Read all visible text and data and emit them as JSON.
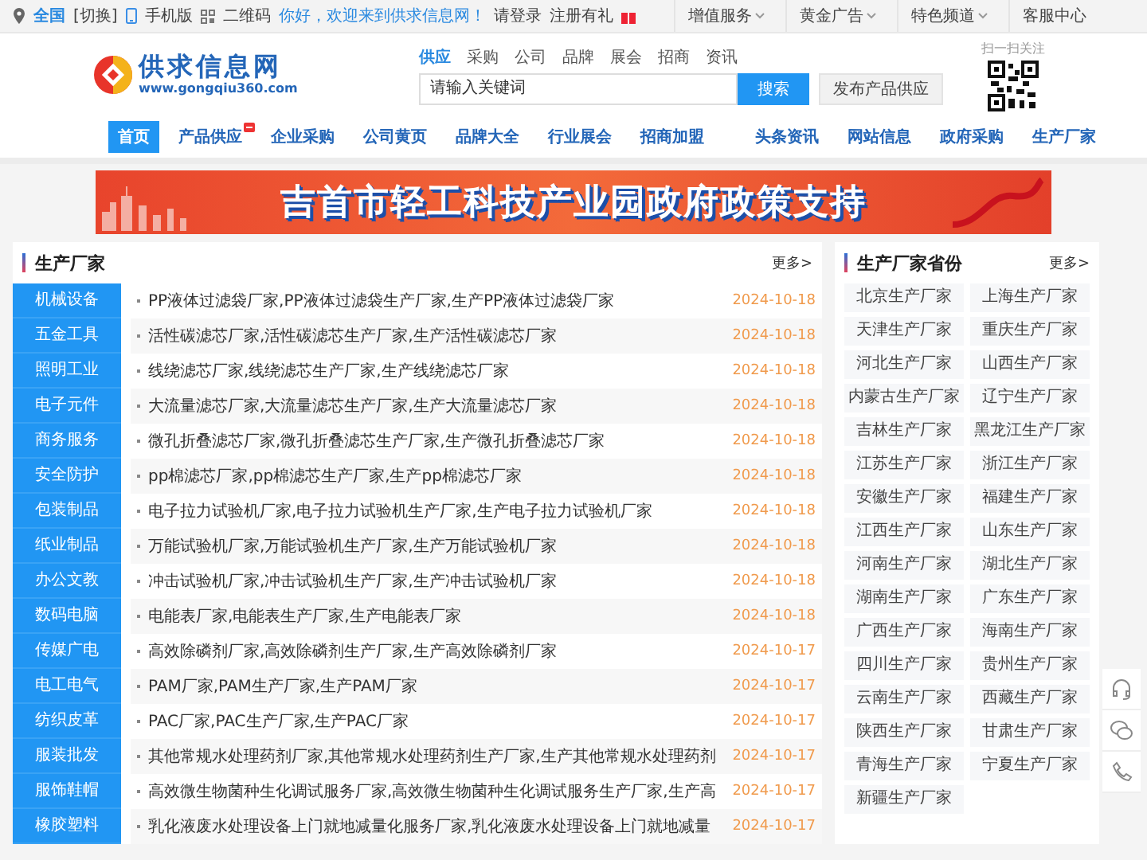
{
  "top_bar": {
    "location": "全国",
    "switch": "[切换]",
    "mobile": "手机版",
    "qrcode": "二维码",
    "welcome": "你好，欢迎来到供求信息网！",
    "login": "请登录",
    "register": "注册有礼",
    "menus": [
      "增值服务",
      "黄金广告",
      "特色频道"
    ],
    "service": "客服中心"
  },
  "logo": {
    "name": "供求信息网",
    "url": "www.gongqiu360.com"
  },
  "search": {
    "tabs": [
      {
        "label": "供应",
        "selected": true
      },
      {
        "label": "采购",
        "selected": false
      },
      {
        "label": "公司",
        "selected": false
      },
      {
        "label": "品牌",
        "selected": false
      },
      {
        "label": "展会",
        "selected": false
      },
      {
        "label": "招商",
        "selected": false
      },
      {
        "label": "资讯",
        "selected": false
      }
    ],
    "placeholder": "请输入关键词",
    "button": "搜索",
    "publish": "发布产品供应"
  },
  "qr": {
    "caption": "扫一扫关注"
  },
  "nav": [
    {
      "label": "首页",
      "selected": true,
      "badge": false
    },
    {
      "label": "产品供应",
      "selected": false,
      "badge": true
    },
    {
      "label": "企业采购",
      "selected": false,
      "badge": false
    },
    {
      "label": "公司黄页",
      "selected": false,
      "badge": false
    },
    {
      "label": "品牌大全",
      "selected": false,
      "badge": false
    },
    {
      "label": "行业展会",
      "selected": false,
      "badge": false
    },
    {
      "label": "招商加盟",
      "selected": false,
      "badge": false
    },
    {
      "label": "头条资讯",
      "selected": false,
      "badge": false
    },
    {
      "label": "网站信息",
      "selected": false,
      "badge": false
    },
    {
      "label": "政府采购",
      "selected": false,
      "badge": false
    },
    {
      "label": "生产厂家",
      "selected": false,
      "badge": false
    }
  ],
  "banner": {
    "title": "吉首市轻工科技产业园政府政策支持"
  },
  "main": {
    "title": "生产厂家",
    "more": "更多>",
    "categories": [
      "机械设备",
      "五金工具",
      "照明工业",
      "电子元件",
      "商务服务",
      "安全防护",
      "包装制品",
      "纸业制品",
      "办公文教",
      "数码电脑",
      "传媒广电",
      "电工电气",
      "纺织皮革",
      "服装批发",
      "服饰鞋帽",
      "橡胶塑料"
    ],
    "rows": [
      {
        "title": "PP液体过滤袋厂家,PP液体过滤袋生产厂家,生产PP液体过滤袋厂家",
        "date": "2024-10-18"
      },
      {
        "title": "活性碳滤芯厂家,活性碳滤芯生产厂家,生产活性碳滤芯厂家",
        "date": "2024-10-18"
      },
      {
        "title": "线绕滤芯厂家,线绕滤芯生产厂家,生产线绕滤芯厂家",
        "date": "2024-10-18"
      },
      {
        "title": "大流量滤芯厂家,大流量滤芯生产厂家,生产大流量滤芯厂家",
        "date": "2024-10-18"
      },
      {
        "title": "微孔折叠滤芯厂家,微孔折叠滤芯生产厂家,生产微孔折叠滤芯厂家",
        "date": "2024-10-18"
      },
      {
        "title": "pp棉滤芯厂家,pp棉滤芯生产厂家,生产pp棉滤芯厂家",
        "date": "2024-10-18"
      },
      {
        "title": "电子拉力试验机厂家,电子拉力试验机生产厂家,生产电子拉力试验机厂家",
        "date": "2024-10-18"
      },
      {
        "title": "万能试验机厂家,万能试验机生产厂家,生产万能试验机厂家",
        "date": "2024-10-18"
      },
      {
        "title": "冲击试验机厂家,冲击试验机生产厂家,生产冲击试验机厂家",
        "date": "2024-10-18"
      },
      {
        "title": "电能表厂家,电能表生产厂家,生产电能表厂家",
        "date": "2024-10-18"
      },
      {
        "title": "高效除磷剂厂家,高效除磷剂生产厂家,生产高效除磷剂厂家",
        "date": "2024-10-17"
      },
      {
        "title": "PAM厂家,PAM生产厂家,生产PAM厂家",
        "date": "2024-10-17"
      },
      {
        "title": "PAC厂家,PAC生产厂家,生产PAC厂家",
        "date": "2024-10-17"
      },
      {
        "title": "其他常规水处理药剂厂家,其他常规水处理药剂生产厂家,生产其他常规水处理药剂",
        "date": "2024-10-17"
      },
      {
        "title": "高效微生物菌种生化调试服务厂家,高效微生物菌种生化调试服务生产厂家,生产高",
        "date": "2024-10-17"
      },
      {
        "title": "乳化液废水处理设备上门就地减量化服务厂家,乳化液废水处理设备上门就地减量",
        "date": "2024-10-17"
      }
    ]
  },
  "provinces": {
    "title": "生产厂家省份",
    "more": "更多>",
    "items": [
      "北京生产厂家",
      "上海生产厂家",
      "天津生产厂家",
      "重庆生产厂家",
      "河北生产厂家",
      "山西生产厂家",
      "内蒙古生产厂家",
      "辽宁生产厂家",
      "吉林生产厂家",
      "黑龙江生产厂家",
      "江苏生产厂家",
      "浙江生产厂家",
      "安徽生产厂家",
      "福建生产厂家",
      "江西生产厂家",
      "山东生产厂家",
      "河南生产厂家",
      "湖北生产厂家",
      "湖南生产厂家",
      "广东生产厂家",
      "广西生产厂家",
      "海南生产厂家",
      "四川生产厂家",
      "贵州生产厂家",
      "云南生产厂家",
      "西藏生产厂家",
      "陕西生产厂家",
      "甘肃生产厂家",
      "青海生产厂家",
      "宁夏生产厂家",
      "新疆生产厂家"
    ]
  }
}
